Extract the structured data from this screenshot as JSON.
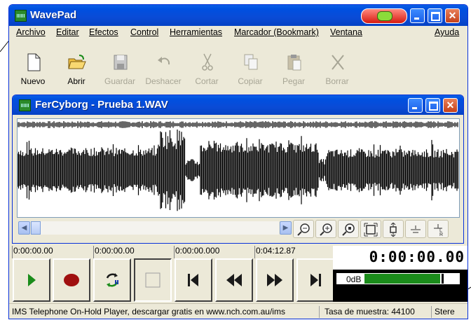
{
  "window": {
    "title": "WavePad"
  },
  "menu": [
    "Archivo",
    "Editar",
    "Efectos",
    "Control",
    "Herramientas",
    "Marcador (Bookmark)",
    "Ventana",
    "Ayuda"
  ],
  "toolbar": [
    {
      "label": "Nuevo",
      "icon": "new-file-icon",
      "enabled": true
    },
    {
      "label": "Abrir",
      "icon": "open-folder-icon",
      "enabled": true
    },
    {
      "label": "Guardar",
      "icon": "save-icon",
      "enabled": false
    },
    {
      "label": "Deshacer",
      "icon": "undo-icon",
      "enabled": false
    },
    {
      "label": "Cortar",
      "icon": "cut-icon",
      "enabled": false
    },
    {
      "label": "Copiar",
      "icon": "copy-icon",
      "enabled": false
    },
    {
      "label": "Pegar",
      "icon": "paste-icon",
      "enabled": false
    },
    {
      "label": "Borrar",
      "icon": "delete-icon",
      "enabled": false
    }
  ],
  "document": {
    "title": "FerCyborg - Prueba 1.WAV"
  },
  "zoom_tools": [
    "zoom-out-icon",
    "zoom-in-icon",
    "zoom-selection-icon",
    "zoom-full-icon",
    "zoom-vertical-icon",
    "vertical-scale-icon",
    "stereo-icon"
  ],
  "transport": {
    "times": [
      "0:00:00.00",
      "0:00:00.00",
      "0:00:00.000",
      "0:04:12.87"
    ],
    "buttons": [
      "play-icon",
      "record-icon",
      "loop-icon",
      "stop-icon",
      "go-to-start-icon",
      "rewind-icon",
      "fast-forward-icon",
      "go-to-end-icon"
    ],
    "clock": "0:00:00.00",
    "meter_label": "0dB"
  },
  "status": {
    "left": "IMS Telephone On-Hold Player, descargar gratis en www.nch.com.au/ims",
    "sample_rate": "Tasa de muestra: 44100",
    "channels": "Stere"
  },
  "colors": {
    "titlebar": "#0a4bd6",
    "waveform": "#000000",
    "meter_fill": "#1b8c1b",
    "play": "#1b8c1b",
    "record": "#a01010"
  }
}
